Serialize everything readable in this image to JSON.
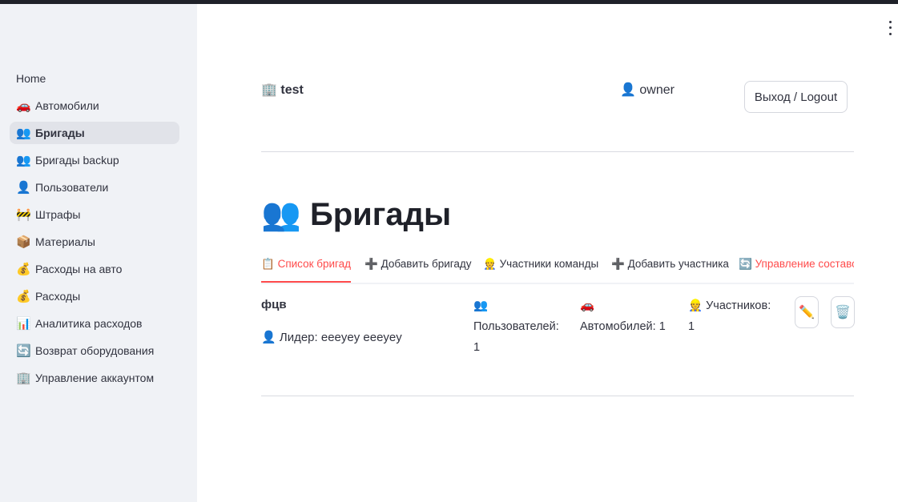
{
  "sidebar": {
    "items": [
      {
        "icon": "",
        "label": "Home"
      },
      {
        "icon": "🚗",
        "label": "Автомобили"
      },
      {
        "icon": "👥",
        "label": "Бригады"
      },
      {
        "icon": "👥",
        "label": "Бригады backup"
      },
      {
        "icon": "👤",
        "label": "Пользователи"
      },
      {
        "icon": "🚧",
        "label": "Штрафы"
      },
      {
        "icon": "📦",
        "label": "Материалы"
      },
      {
        "icon": "💰",
        "label": "Расходы на авто"
      },
      {
        "icon": "💰",
        "label": "Расходы"
      },
      {
        "icon": "📊",
        "label": "Аналитика расходов"
      },
      {
        "icon": "🔄",
        "label": "Возврат оборудования"
      },
      {
        "icon": "🏢",
        "label": "Управление аккаунтом"
      }
    ],
    "active_index": 2
  },
  "header": {
    "org_icon": "🏢",
    "org_name": "test",
    "user_icon": "👤",
    "user_role": "owner",
    "logout_label": "Выход / Logout"
  },
  "page": {
    "title_icon": "👥",
    "title": "Бригады"
  },
  "tabs": [
    {
      "icon": "📋",
      "label": "Список бригад"
    },
    {
      "icon": "➕",
      "label": "Добавить бригаду"
    },
    {
      "icon": "👷",
      "label": "Участники команды"
    },
    {
      "icon": "➕",
      "label": "Добавить участника"
    },
    {
      "icon": "🔄",
      "label": "Управление составом"
    }
  ],
  "team": {
    "name": "фцв",
    "leader_icon": "👤",
    "leader": "Лидер: eeeyey eeeyey",
    "users_icon": "👥",
    "users_label": "Пользователей:",
    "users_count": "1",
    "cars_icon": "🚗",
    "cars_label": "Автомобилей: 1",
    "members_icon": "👷",
    "members_label": "Участников:",
    "members_count": "1",
    "edit_icon": "✏️",
    "delete_icon": "🗑️"
  },
  "colors": {
    "accent": "#ff4b4b",
    "sidebar_bg": "#f0f2f6",
    "text": "#31333f"
  }
}
